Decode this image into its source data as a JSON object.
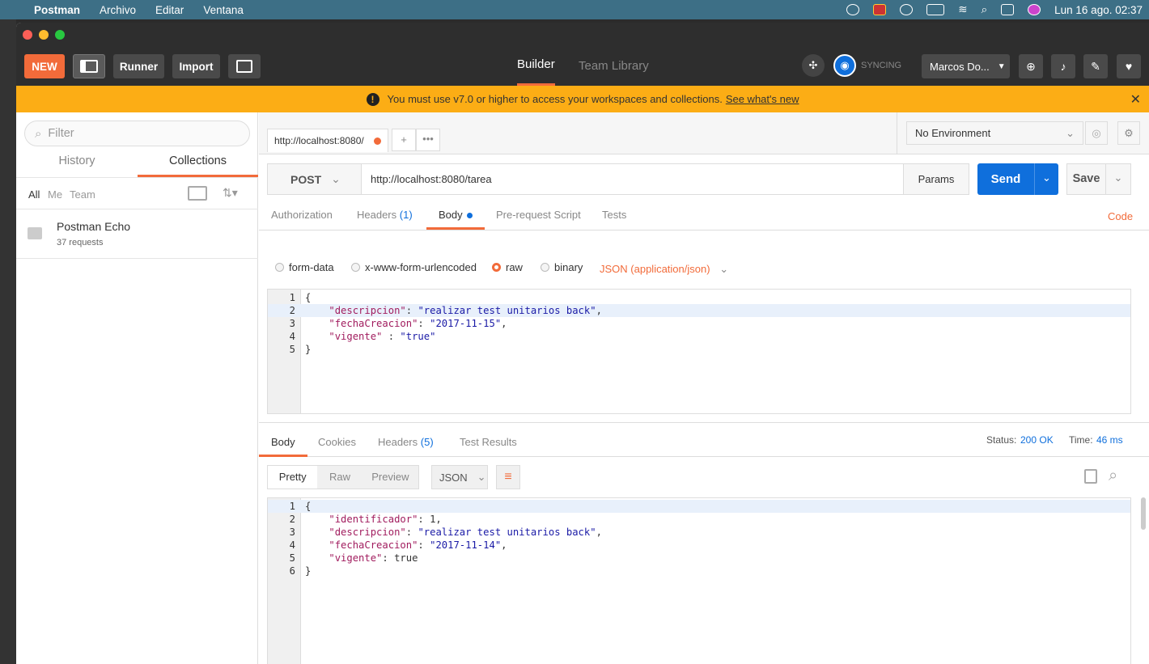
{
  "menubar": {
    "app": "Postman",
    "items": [
      "Archivo",
      "Editar",
      "Ventana"
    ],
    "clock": "Lun 16 ago.  02:37"
  },
  "toolbar": {
    "new_label": "NEW",
    "runner_label": "Runner",
    "import_label": "Import",
    "tabs": [
      "Builder",
      "Team Library"
    ],
    "sync_label": "SYNCING",
    "user_label": "Marcos Do..."
  },
  "banner": {
    "text": "You must use v7.0 or higher to access your workspaces and collections.",
    "link": "See what's new"
  },
  "sidebar": {
    "filter_placeholder": "Filter",
    "tabs": [
      "History",
      "Collections"
    ],
    "filters": [
      "All",
      "Me",
      "Team"
    ],
    "collection": {
      "name": "Postman Echo",
      "count": "37 requests"
    }
  },
  "request": {
    "tab_url": "http://localhost:8080/",
    "environment": "No Environment",
    "method": "POST",
    "url": "http://localhost:8080/tarea",
    "params_label": "Params",
    "send_label": "Send",
    "save_label": "Save",
    "subtabs": [
      "Authorization",
      "Headers",
      "Body",
      "Pre-request Script",
      "Tests"
    ],
    "headers_count": "(1)",
    "code_label": "Code",
    "body_modes": [
      "form-data",
      "x-www-form-urlencoded",
      "raw",
      "binary"
    ],
    "content_type": "JSON (application/json)",
    "body_lines": [
      {
        "n": "1",
        "parts": [
          [
            "p",
            "{"
          ]
        ]
      },
      {
        "n": "2",
        "parts": [
          [
            "p",
            "    "
          ],
          [
            "k",
            "\"descripcion\""
          ],
          [
            "p",
            ": "
          ],
          [
            "s",
            "\"realizar test unitarios back\""
          ],
          [
            "p",
            ","
          ]
        ]
      },
      {
        "n": "3",
        "parts": [
          [
            "p",
            "    "
          ],
          [
            "k",
            "\"fechaCreacion\""
          ],
          [
            "p",
            ": "
          ],
          [
            "s",
            "\"2017-11-15\""
          ],
          [
            "p",
            ","
          ]
        ]
      },
      {
        "n": "4",
        "parts": [
          [
            "p",
            "    "
          ],
          [
            "k",
            "\"vigente\""
          ],
          [
            "p",
            " : "
          ],
          [
            "s",
            "\"true\""
          ]
        ]
      },
      {
        "n": "5",
        "parts": [
          [
            "p",
            "}"
          ]
        ]
      }
    ]
  },
  "response": {
    "tabs": [
      "Body",
      "Cookies",
      "Headers",
      "Test Results"
    ],
    "headers_count": "(5)",
    "status_label": "Status:",
    "status_value": "200 OK",
    "time_label": "Time:",
    "time_value": "46 ms",
    "view_modes": [
      "Pretty",
      "Raw",
      "Preview"
    ],
    "format": "JSON",
    "body_lines": [
      {
        "n": "1",
        "parts": [
          [
            "p",
            "{"
          ]
        ]
      },
      {
        "n": "2",
        "parts": [
          [
            "p",
            "    "
          ],
          [
            "k",
            "\"identificador\""
          ],
          [
            "p",
            ": 1,"
          ]
        ]
      },
      {
        "n": "3",
        "parts": [
          [
            "p",
            "    "
          ],
          [
            "k",
            "\"descripcion\""
          ],
          [
            "p",
            ": "
          ],
          [
            "s",
            "\"realizar test unitarios back\""
          ],
          [
            "p",
            ","
          ]
        ]
      },
      {
        "n": "4",
        "parts": [
          [
            "p",
            "    "
          ],
          [
            "k",
            "\"fechaCreacion\""
          ],
          [
            "p",
            ": "
          ],
          [
            "s",
            "\"2017-11-14\""
          ],
          [
            "p",
            ","
          ]
        ]
      },
      {
        "n": "5",
        "parts": [
          [
            "p",
            "    "
          ],
          [
            "k",
            "\"vigente\""
          ],
          [
            "p",
            ": true"
          ]
        ]
      },
      {
        "n": "6",
        "parts": [
          [
            "p",
            "}"
          ]
        ]
      }
    ]
  },
  "colors": {
    "accent": "#f26b3a",
    "send": "#0f6fdc",
    "banner": "#fcad15",
    "link": "#1a73e8"
  }
}
